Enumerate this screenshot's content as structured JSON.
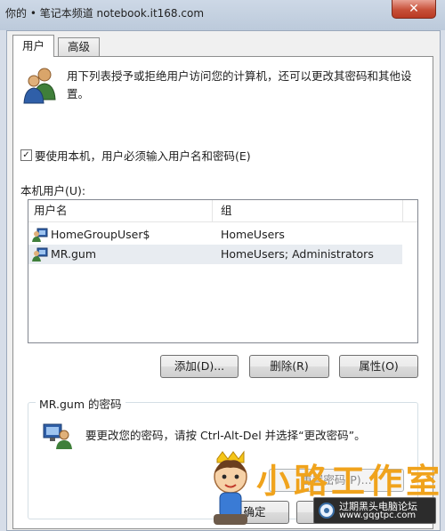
{
  "window": {
    "title": "你的 • 笔记本频道 notebook.it168.com",
    "close_glyph": "✕"
  },
  "tabs": [
    {
      "label": "用户",
      "active": true
    },
    {
      "label": "高级",
      "active": false
    }
  ],
  "intro": {
    "icon": "users-icon",
    "text": "用下列表授予或拒绝用户访问您的计算机，还可以更改其密码和其他设置。"
  },
  "require_login": {
    "checked": true,
    "check_glyph": "✓",
    "label": "要使用本机，用户必须输入用户名和密码(E)"
  },
  "users_label": "本机用户(U):",
  "user_table": {
    "columns": [
      "用户名",
      "组"
    ],
    "rows": [
      {
        "name": "HomeGroupUser$",
        "group": "HomeUsers",
        "selected": false
      },
      {
        "name": "MR.gum",
        "group": "HomeUsers; Administrators",
        "selected": true
      }
    ]
  },
  "buttons": {
    "add": "添加(D)...",
    "remove": "删除(R)",
    "properties": "属性(O)",
    "reset_password": "重置密码(P)...",
    "ok": "确定",
    "cancel": "取"
  },
  "password_group": {
    "title": "MR.gum 的密码",
    "text": "要更改您的密码，请按 Ctrl-Alt-Del 并选择“更改密码”。"
  },
  "watermark": {
    "brand": "小路工作室",
    "badge_line1": "过期黑头电脑论坛",
    "badge_line2": "www.gqgtpc.com"
  },
  "colors": {
    "accent": "#3a6ea5",
    "watermark": "#f0a31c"
  }
}
